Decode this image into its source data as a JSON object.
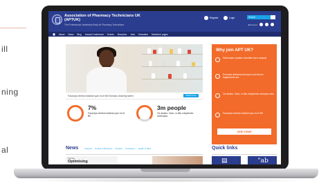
{
  "background_fragment": {
    "lines": [
      "ill",
      "ning",
      "al"
    ]
  },
  "site": {
    "org_name": "Association of Pharmacy Technicians UK (APTUK)",
    "tagline": "The Professional Leadership Body for Pharmacy Technicians",
    "register_label": "Register",
    "login_label": "Login",
    "search_placeholder": "Search",
    "join_us_label": "Join us on",
    "social_icons": [
      "twitter-icon",
      "facebook-icon",
      "linkedin-icon"
    ]
  },
  "nav": {
    "items": [
      "About",
      "News",
      "Blog",
      "Annual Conference",
      "Events",
      "Branches",
      "Jobs",
      "Education",
      "Members' pages"
    ]
  },
  "hero": {
    "caption": "Faccuipa ventios totatium que es el Bil Evendus dolorreg tatem",
    "button": "Read more",
    "prev_arrow": "‹",
    "next_arrow": "›"
  },
  "stats": [
    {
      "value": "7%",
      "desc": "Faccuipa ventios totatium que es el Bil"
    },
    {
      "value": "3m people",
      "desc": "Os alcabo. Num, si dita voluptentio sebocipsu."
    }
  ],
  "why_join": {
    "title": "Why join APT UK?",
    "items": [
      "Salmonque quiaten oboritam taco umquat",
      "Evendus dolorrep bnerrquot aut essum fugiandunts aut",
      "Os alcabo. Num, si dita voluptentio setocipsu tam",
      "Faccuipa ventios totatium que es el Bil"
    ],
    "cta": "Join now!"
  },
  "news": {
    "heading": "News",
    "tabs": [
      "Analysis",
      "People & Business",
      "Practice",
      "Profession",
      "Health & NHS"
    ],
    "card_badge": "Practice",
    "card_title": "Optimising"
  },
  "quick_links": {
    "heading": "Quick links",
    "tiles": [
      "▤",
      "“ab"
    ]
  },
  "colors": {
    "header_blue": "#2b3d8f",
    "nav_blue": "#1e2c6e",
    "accent_orange": "#f26b2a",
    "accent_cyan": "#1aa3e8"
  }
}
